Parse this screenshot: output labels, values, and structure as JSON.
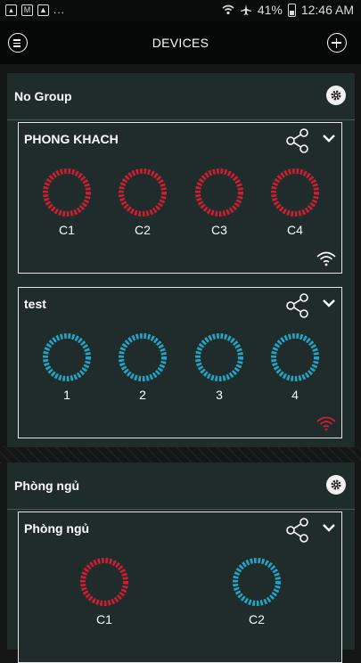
{
  "status_bar": {
    "battery": "41%",
    "time": "12:46 AM",
    "overflow": "..."
  },
  "top_bar": {
    "title": "DEVICES",
    "menu_icon": "menu-icon",
    "add_icon": "plus-icon"
  },
  "colors": {
    "red": "#d21e33",
    "cyan": "#23a6c8",
    "panel": "#1e2c2a",
    "card_border": "#e6e6e6"
  },
  "groups": [
    {
      "name": "No Group",
      "devices": [
        {
          "name": "PHONG KHACH",
          "channels": [
            "C1",
            "C2",
            "C3",
            "C4"
          ],
          "channel_state": "red",
          "wifi": "connected"
        },
        {
          "name": "test",
          "channels": [
            "1",
            "2",
            "3",
            "4"
          ],
          "channel_state": "cyan",
          "wifi": "disconnected"
        }
      ]
    },
    {
      "name": "Phòng ngủ",
      "devices": [
        {
          "name": "Phòng ngủ",
          "channels": [
            "C1",
            "C2"
          ],
          "channel_state": [
            "red",
            "cyan"
          ]
        }
      ]
    }
  ]
}
